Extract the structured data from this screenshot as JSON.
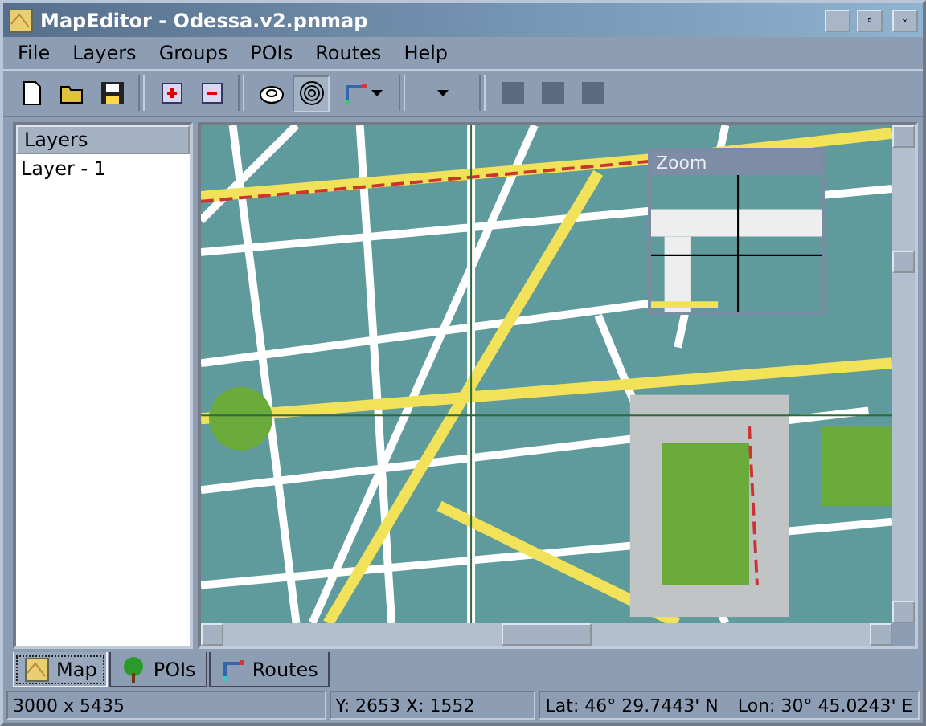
{
  "window": {
    "title": "MapEditor - Odessa.v2.pnmap"
  },
  "menu": [
    "File",
    "Layers",
    "Groups",
    "POIs",
    "Routes",
    "Help"
  ],
  "toolbar": [
    {
      "kind": "new",
      "pressed": false
    },
    {
      "kind": "open",
      "pressed": false
    },
    {
      "kind": "save",
      "pressed": false
    },
    {
      "kind": "separator"
    },
    {
      "kind": "zoom-in",
      "pressed": false
    },
    {
      "kind": "zoom-out",
      "pressed": false
    },
    {
      "kind": "separator"
    },
    {
      "kind": "pan",
      "pressed": false
    },
    {
      "kind": "target",
      "pressed": true
    },
    {
      "kind": "route",
      "pressed": false
    },
    {
      "kind": "separator"
    },
    {
      "kind": "dropdown",
      "pressed": false
    },
    {
      "kind": "separator"
    },
    {
      "kind": "square",
      "pressed": false
    },
    {
      "kind": "square",
      "pressed": false
    },
    {
      "kind": "square",
      "pressed": false
    }
  ],
  "layers_panel": {
    "title": "Layers",
    "items": [
      "Layer - 1"
    ]
  },
  "zoom_window": {
    "title": "Zoom"
  },
  "tabs": [
    {
      "label": "Map",
      "kind": "map",
      "selected": true
    },
    {
      "label": "POIs",
      "kind": "tree",
      "selected": false
    },
    {
      "label": "Routes",
      "kind": "route",
      "selected": false
    }
  ],
  "status_bar": [
    [
      "3000 x 5435"
    ],
    [
      "Y: 2653 X: 1552"
    ],
    [
      "Lat: 46° 29.7443' N",
      "Lon: 30° 45.0243' E"
    ]
  ]
}
